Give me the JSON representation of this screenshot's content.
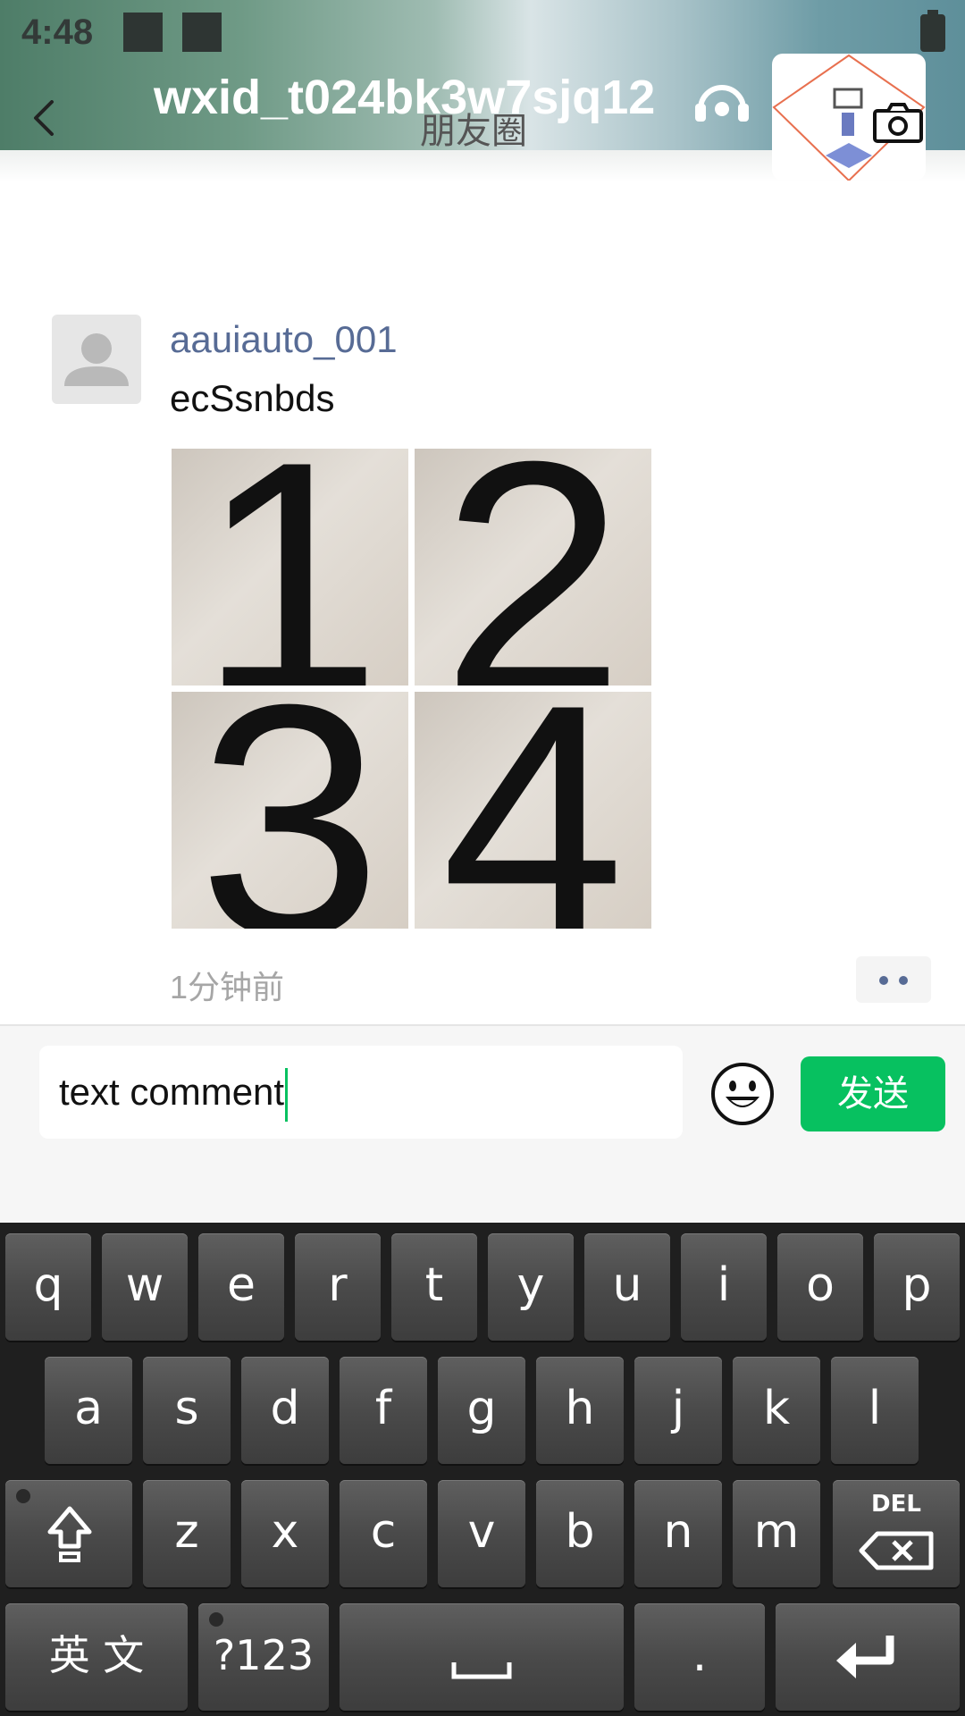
{
  "status_bar": {
    "time": "4:48"
  },
  "header": {
    "username": "wxid_t024bk3w7sjq12",
    "page_title": "朋友圈"
  },
  "post": {
    "author": "aauiauto_001",
    "text": "ecSsnbds",
    "photos": [
      "1",
      "2",
      "3",
      "4"
    ],
    "time": "1分钟前"
  },
  "comment": {
    "value": "text comment",
    "send_label": "发送"
  },
  "keyboard": {
    "row1": [
      "q",
      "w",
      "e",
      "r",
      "t",
      "y",
      "u",
      "i",
      "o",
      "p"
    ],
    "row2": [
      "a",
      "s",
      "d",
      "f",
      "g",
      "h",
      "j",
      "k",
      "l"
    ],
    "row3": [
      "z",
      "x",
      "c",
      "v",
      "b",
      "n",
      "m"
    ],
    "del_label": "DEL",
    "lang_label": "英 文",
    "symbols_label": "?123",
    "period_label": "."
  },
  "colors": {
    "accent_green": "#07c160",
    "link_blue": "#576b95"
  }
}
